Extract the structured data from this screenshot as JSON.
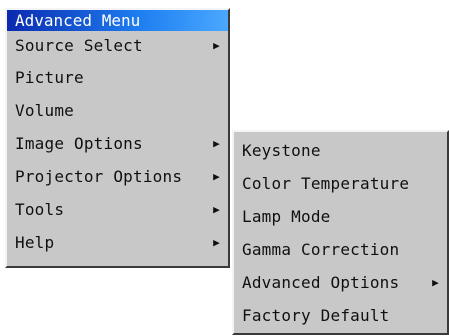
{
  "main_menu": {
    "title": "Advanced Menu",
    "items": [
      {
        "label": "Source Select",
        "submenu_arrow": "▶"
      },
      {
        "label": "Picture",
        "submenu_arrow": ""
      },
      {
        "label": "Volume",
        "submenu_arrow": ""
      },
      {
        "label": "Image Options",
        "submenu_arrow": "▶"
      },
      {
        "label": "Projector Options",
        "submenu_arrow": "▶"
      },
      {
        "label": "Tools",
        "submenu_arrow": "▶"
      },
      {
        "label": "Help",
        "submenu_arrow": "▶"
      }
    ]
  },
  "sub_menu": {
    "items": [
      {
        "label": "Keystone",
        "submenu_arrow": ""
      },
      {
        "label": "Color Temperature",
        "submenu_arrow": ""
      },
      {
        "label": "Lamp Mode",
        "submenu_arrow": ""
      },
      {
        "label": "Gamma Correction",
        "submenu_arrow": ""
      },
      {
        "label": "Advanced Options",
        "submenu_arrow": "▶"
      },
      {
        "label": "Factory Default",
        "submenu_arrow": ""
      }
    ]
  },
  "colors": {
    "menu_background": "#c8c8c8",
    "title_gradient_start": "#0a2ab0",
    "title_gradient_end": "#4aa8ff",
    "text": "#101010"
  }
}
